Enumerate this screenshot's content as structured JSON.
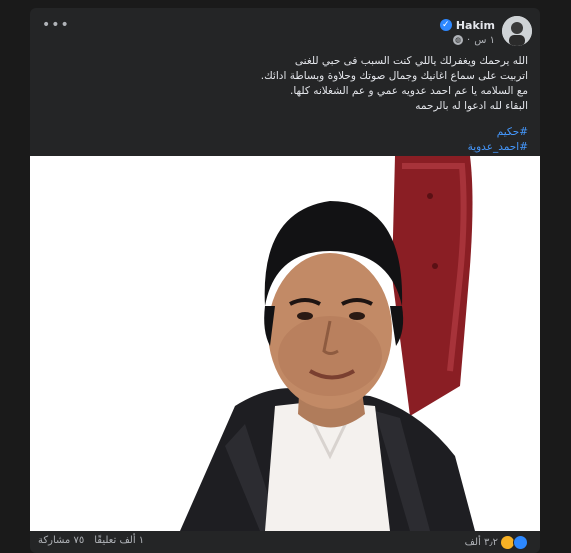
{
  "post": {
    "author": "Hakim",
    "time": "١ س",
    "more_glyph": "•••",
    "lines": [
      "الله يرحمك ويغفرلك ياللي كنت السبب فى حبي للغنى",
      "اتربيت على سماع اغانيك وجمال صوتك وحلاوة وبساطة ادائك.",
      "مع السلامه يا عم احمد عدويه عمي و عم الشغلانه كلها.",
      "البقاء لله ادعوا له بالرحمه"
    ],
    "hashtags": [
      "#حكيم",
      "#احمد_عدوية"
    ]
  },
  "footer": {
    "reactions_count": "٣٫٢ ألف",
    "comments": "١ ألف تعليقًا",
    "shares": "٧٥ مشاركة"
  },
  "icons": {
    "verified": "verified-badge-icon",
    "audience": "globe-icon",
    "more": "more-options-icon",
    "reaction1": "like-reaction-icon",
    "reaction2": "sad-reaction-icon"
  },
  "colors": {
    "background": "#242526",
    "text": "#e4e6eb",
    "secondary_text": "#b0b3b8",
    "link": "#4599ff",
    "verified": "#2d88ff"
  }
}
